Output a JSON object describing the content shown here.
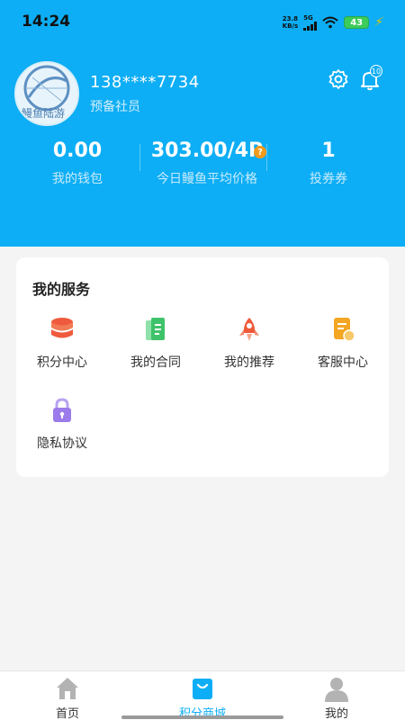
{
  "status_bar": {
    "time": "14:24",
    "net_speed_value": "23.8",
    "net_speed_unit": "KB/s",
    "network": "5G",
    "battery": "43"
  },
  "profile": {
    "avatar_text": "鳗鱼陆游",
    "phone": "138****7734",
    "member_level": "预备社员",
    "notification_count": "10"
  },
  "stats": [
    {
      "value": "0.00",
      "label": "我的钱包"
    },
    {
      "value": "303.00/4P",
      "label": "今日鳗鱼平均价格",
      "help": "?"
    },
    {
      "value": "1",
      "label": "投券券"
    }
  ],
  "services": {
    "title": "我的服务",
    "items": [
      {
        "label": "积分中心",
        "icon": "points-stack-icon",
        "color": "#ef5a3c"
      },
      {
        "label": "我的合同",
        "icon": "contract-icon",
        "color": "#3fc36a"
      },
      {
        "label": "我的推荐",
        "icon": "rocket-icon",
        "color": "#f05a3a"
      },
      {
        "label": "客服中心",
        "icon": "customer-service-icon",
        "color": "#f2a623"
      },
      {
        "label": "隐私协议",
        "icon": "privacy-lock-icon",
        "color": "#9c7bea"
      }
    ]
  },
  "tabbar": {
    "items": [
      {
        "label": "首页",
        "icon": "home-icon",
        "active": false
      },
      {
        "label": "积分商城",
        "icon": "shopping-bag-icon",
        "active": true
      },
      {
        "label": "我的",
        "icon": "person-icon",
        "active": false
      }
    ]
  },
  "colors": {
    "header_bg": "#0daef5",
    "accent": "#0daef5",
    "help_badge": "#f39a1b"
  }
}
